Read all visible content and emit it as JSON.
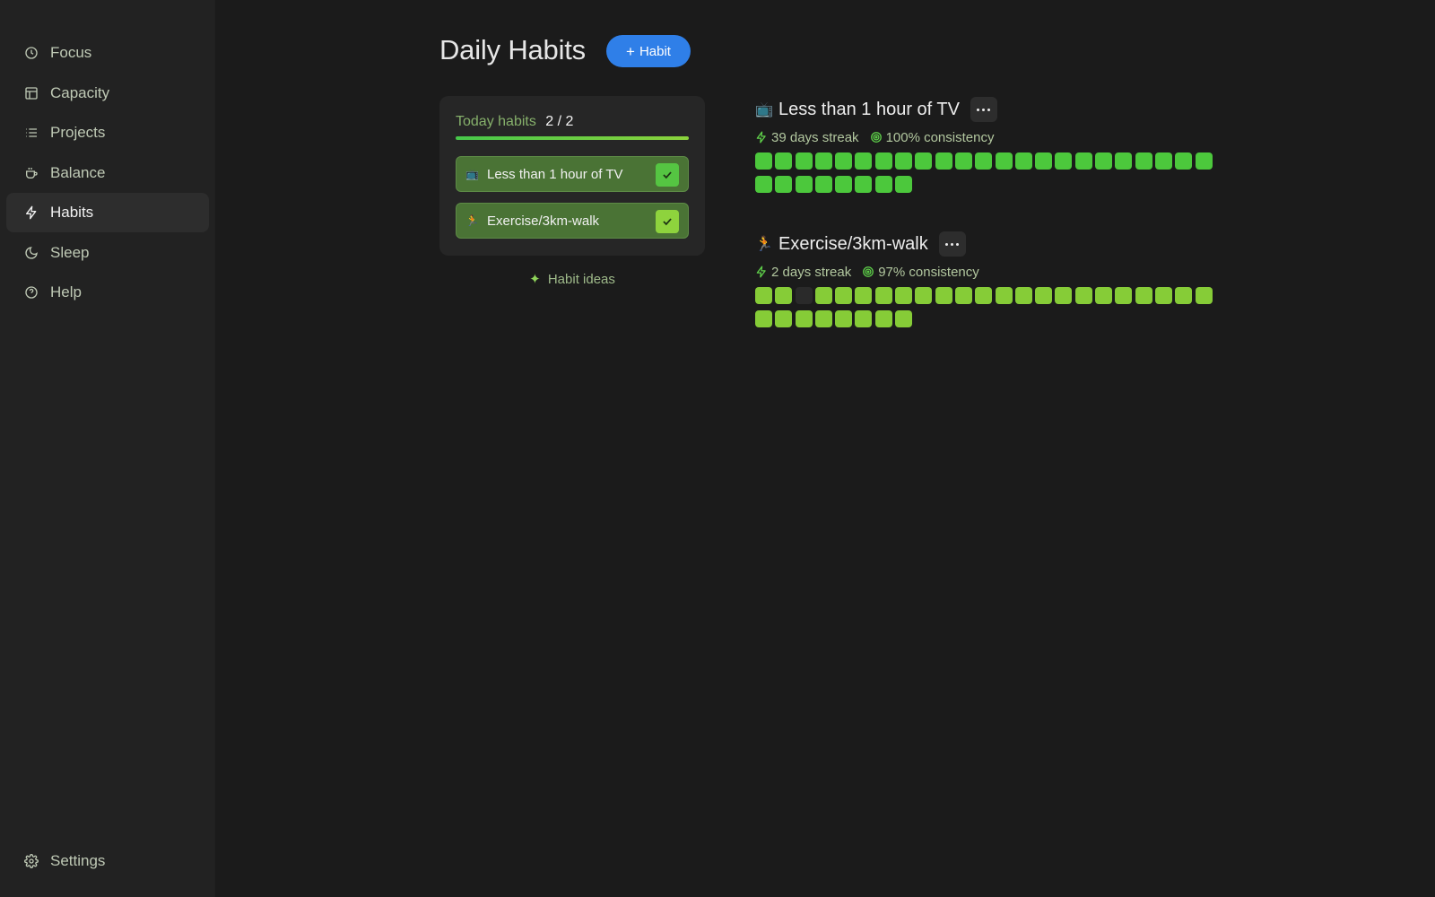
{
  "sidebar": {
    "items": [
      {
        "label": "Focus",
        "icon": "clock-icon",
        "active": false
      },
      {
        "label": "Capacity",
        "icon": "layout-icon",
        "active": false
      },
      {
        "label": "Projects",
        "icon": "list-icon",
        "active": false
      },
      {
        "label": "Balance",
        "icon": "cup-icon",
        "active": false
      },
      {
        "label": "Habits",
        "icon": "bolt-icon",
        "active": true
      },
      {
        "label": "Sleep",
        "icon": "moon-icon",
        "active": false
      },
      {
        "label": "Help",
        "icon": "help-circle-icon",
        "active": false
      }
    ],
    "settings_label": "Settings"
  },
  "header": {
    "title": "Daily Habits",
    "add_label": "Habit"
  },
  "today": {
    "label": "Today habits",
    "count": "2 / 2",
    "progress_fraction": 1.0,
    "items": [
      {
        "emoji": "📺",
        "name": "Less than 1 hour of TV",
        "checked": true,
        "check_color": "#55c542"
      },
      {
        "emoji": "🏃",
        "name": "Exercise/3km-walk",
        "checked": true,
        "check_color": "#8ed33d"
      }
    ]
  },
  "ideas_label": "Habit ideas",
  "habits": [
    {
      "emoji": "📺",
      "name": "Less than 1 hour of TV",
      "streak": "39 days streak",
      "consistency": "100% consistency",
      "color": "#4cc83c",
      "days": [
        1,
        1,
        1,
        1,
        1,
        1,
        1,
        1,
        1,
        1,
        1,
        1,
        1,
        1,
        1,
        1,
        1,
        1,
        1,
        1,
        1,
        1,
        1,
        1,
        1,
        1,
        1,
        1,
        1,
        1,
        1
      ]
    },
    {
      "emoji": "🏃",
      "name": "Exercise/3km-walk",
      "streak": "2 days streak",
      "consistency": "97% consistency",
      "color": "#86cc37",
      "days": [
        1,
        1,
        0,
        1,
        1,
        1,
        1,
        1,
        1,
        1,
        1,
        1,
        1,
        1,
        1,
        1,
        1,
        1,
        1,
        1,
        1,
        1,
        1,
        1,
        1,
        1,
        1,
        1,
        1,
        1,
        1
      ]
    }
  ],
  "colors": {
    "accent": "#2f7fe8",
    "empty_cell": "#2a2a2a"
  }
}
